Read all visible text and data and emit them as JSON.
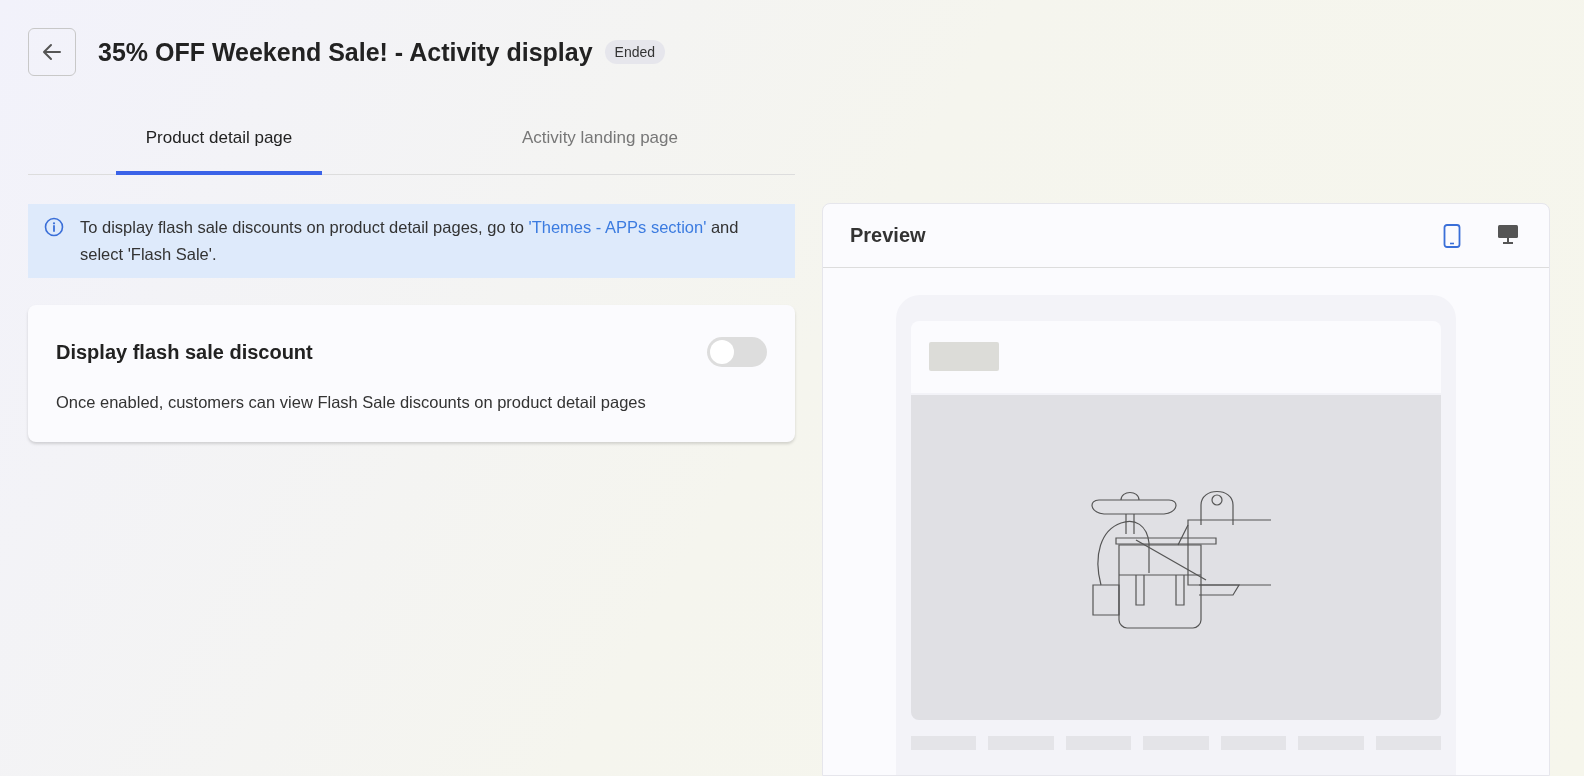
{
  "header": {
    "title": "35% OFF Weekend Sale! - Activity display",
    "status": "Ended"
  },
  "tabs": [
    {
      "label": "Product detail page",
      "selected": true
    },
    {
      "label": "Activity landing page",
      "selected": false
    }
  ],
  "notice": {
    "text_before": "To display flash sale discounts on product detail pages, go to ",
    "link": "'Themes - APPs section'",
    "text_after": " and select 'Flash Sale'."
  },
  "setting": {
    "title": "Display flash sale discount",
    "on": false,
    "description": "Once enabled, customers can view Flash Sale discounts on product detail pages"
  },
  "preview": {
    "title": "Preview",
    "devices": [
      {
        "kind": "mobile",
        "selected": true
      },
      {
        "kind": "desktop",
        "selected": false
      }
    ]
  }
}
